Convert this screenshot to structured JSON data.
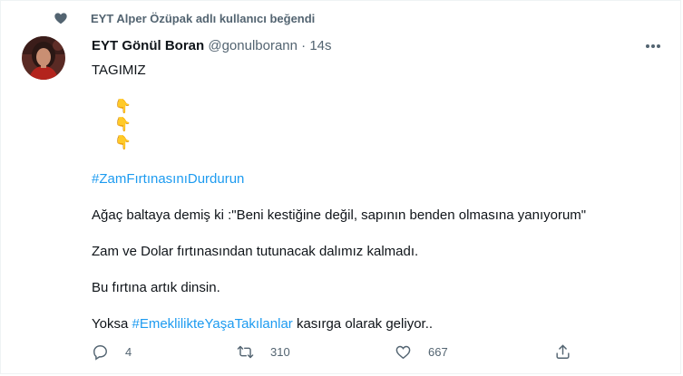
{
  "social_context": {
    "icon": "heart-icon",
    "text": "EYT Alper Özüpak adlı kullanıcı beğendi"
  },
  "author": {
    "name": "EYT Gönül Boran",
    "handle": "@gonulborann",
    "separator": "·",
    "time": "14s"
  },
  "content": {
    "line1": "TAGIMIZ",
    "emojis": [
      "👇",
      "👇",
      "👇"
    ],
    "hashtag1": "#ZamFırtınasınıDurdurun",
    "line2": "Ağaç baltaya demiş ki :\"Beni kestiğine değil, sapının benden olmasına yanıyorum\"",
    "line3": "Zam ve Dolar fırtınasından tutunacak dalımız kalmadı.",
    "line4": "Bu fırtına artık dinsin.",
    "line5_prefix": "Yoksa ",
    "hashtag2": "#EmeklilikteYaşaTakılanlar",
    "line5_suffix": " kasırga olarak geliyor.."
  },
  "actions": {
    "reply_count": "4",
    "retweet_count": "310",
    "like_count": "667"
  },
  "colors": {
    "accent": "#1d9bf0",
    "secondary_text": "#536471",
    "primary_text": "#0f1419"
  }
}
